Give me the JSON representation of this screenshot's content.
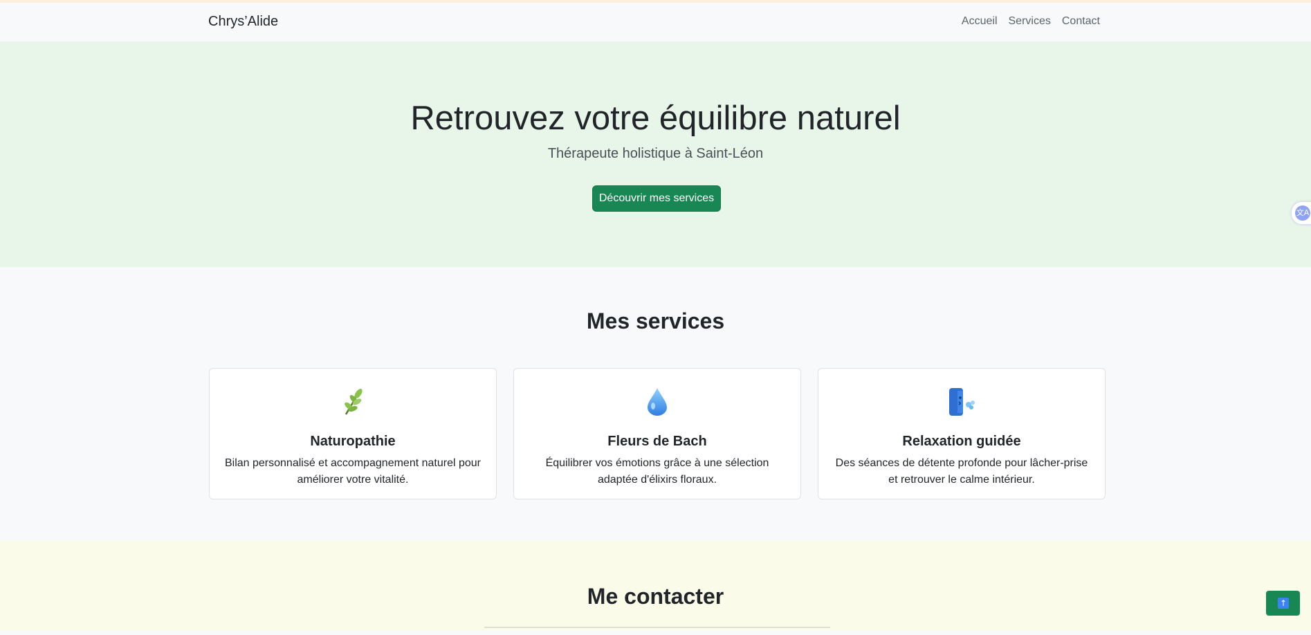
{
  "navbar": {
    "brand": "Chrys’Alide",
    "links": [
      "Accueil",
      "Services",
      "Contact"
    ]
  },
  "hero": {
    "title": "Retrouvez votre équilibre naturel",
    "subtitle": "Thérapeute holistique à Saint-Léon",
    "cta_label": "Découvrir mes services"
  },
  "services": {
    "title": "Mes services",
    "cards": [
      {
        "icon": "herb-icon",
        "title": "Naturopathie",
        "text": "Bilan personnalisé et accompagnement naturel pour améliorer votre vitalité."
      },
      {
        "icon": "droplet-icon",
        "title": "Fleurs de Bach",
        "text": "Équilibrer vos émotions grâce à une sélection adaptée d'élixirs floraux."
      },
      {
        "icon": "face-exhaling-icon",
        "title": "Relaxation guidée",
        "text": "Des séances de détente profonde pour lâcher-prise et retrouver le calme intérieur."
      }
    ]
  },
  "contact": {
    "title": "Me contacter"
  },
  "widgets": {
    "translate_icon": "translate-icon",
    "scroll_top_icon": "arrow-up-icon"
  },
  "colors": {
    "primary_green": "#198754",
    "hero_bg": "#e8f5e9",
    "contact_bg": "#fafbe8"
  }
}
